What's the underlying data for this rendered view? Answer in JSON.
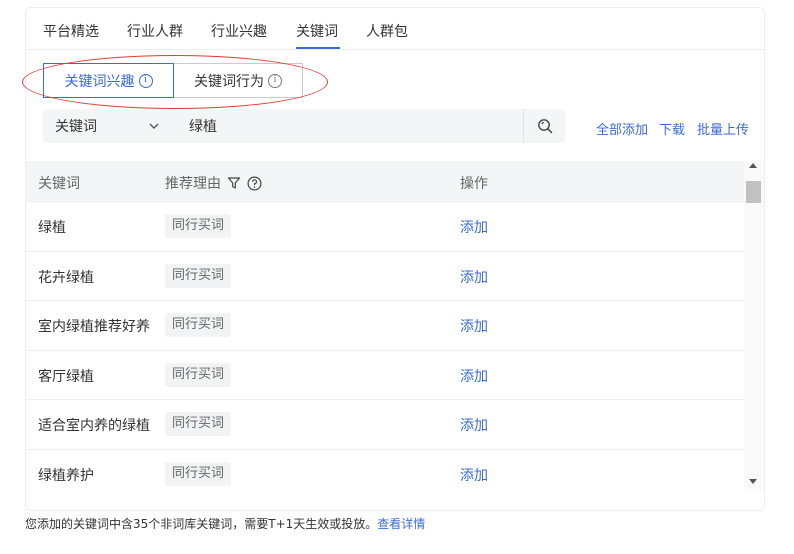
{
  "tabs": [
    {
      "label": "平台精选"
    },
    {
      "label": "行业人群"
    },
    {
      "label": "行业兴趣"
    },
    {
      "label": "关键词"
    },
    {
      "label": "人群包"
    }
  ],
  "active_tab": "关键词",
  "subtabs": [
    {
      "label": "关键词兴趣",
      "active": true
    },
    {
      "label": "关键词行为",
      "active": false
    }
  ],
  "info_icon_glyph": "i",
  "search": {
    "select_value": "关键词",
    "query": "绿植"
  },
  "actions": {
    "add_all": "全部添加",
    "download": "下载",
    "bulk_upload": "批量上传"
  },
  "table": {
    "columns": [
      "关键词",
      "推荐理由",
      "操作"
    ],
    "rows": [
      {
        "keyword": "绿植",
        "reason": "同行买词",
        "action": "添加"
      },
      {
        "keyword": "花卉绿植",
        "reason": "同行买词",
        "action": "添加"
      },
      {
        "keyword": "室内绿植推荐好养",
        "reason": "同行买词",
        "action": "添加"
      },
      {
        "keyword": "客厅绿植",
        "reason": "同行买词",
        "action": "添加"
      },
      {
        "keyword": "适合室内养的绿植",
        "reason": "同行买词",
        "action": "添加"
      },
      {
        "keyword": "绿植养护",
        "reason": "同行买词",
        "action": "添加"
      }
    ]
  },
  "footer": {
    "text": "您添加的关键词中含35个非词库关键词，需要T+1天生效或投放。",
    "link": "查看详情"
  },
  "colors": {
    "accent": "#3b6bd6",
    "highlight_ellipse": "#e53935"
  }
}
